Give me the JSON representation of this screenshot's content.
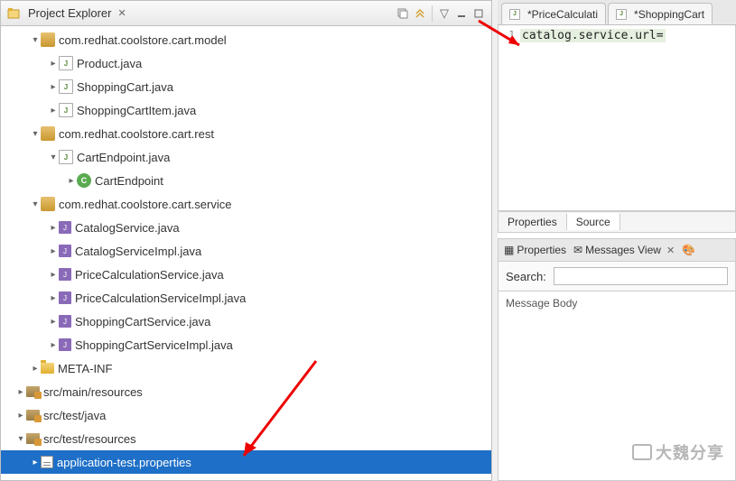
{
  "project_explorer": {
    "title": "Project Explorer",
    "tree": {
      "pkg_model": "com.redhat.coolstore.cart.model",
      "product": "Product.java",
      "shoppingcart": "ShoppingCart.java",
      "shoppingcartitem": "ShoppingCartItem.java",
      "pkg_rest": "com.redhat.coolstore.cart.rest",
      "cartendpoint_java": "CartEndpoint.java",
      "cartendpoint_cls": "CartEndpoint",
      "pkg_service": "com.redhat.coolstore.cart.service",
      "catalogservice": "CatalogService.java",
      "catalogserviceimpl": "CatalogServiceImpl.java",
      "pricecalcservice": "PriceCalculationService.java",
      "pricecalcserviceimpl": "PriceCalculationServiceImpl.java",
      "shoppingcartservice": "ShoppingCartService.java",
      "shoppingcartserviceimpl": "ShoppingCartServiceImpl.java",
      "metainf": "META-INF",
      "src_main_res": "src/main/resources",
      "src_test_java": "src/test/java",
      "src_test_res": "src/test/resources",
      "app_test_props": "application-test.properties"
    }
  },
  "editor": {
    "tab1": "*PriceCalculati",
    "tab2": "*ShoppingCart",
    "line1_num": "1",
    "line1": "catalog.service.url=",
    "bottom_tab1": "Properties",
    "bottom_tab2": "Source"
  },
  "views": {
    "properties": "Properties",
    "messages": "Messages View",
    "search_label": "Search:",
    "msg_body": "Message Body"
  },
  "watermark": "大魏分享"
}
